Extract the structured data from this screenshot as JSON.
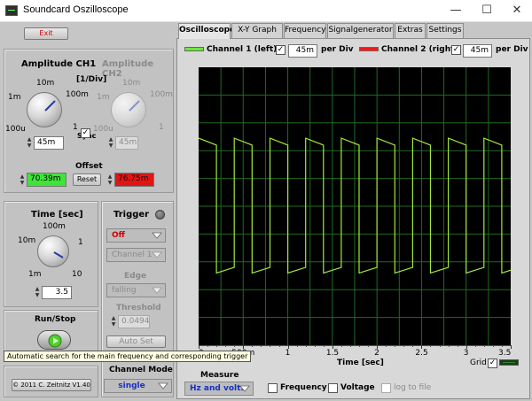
{
  "window": {
    "title": "Soundcard Oszilloscope",
    "minimize": "—",
    "maximize": "☐",
    "close": "✕"
  },
  "left": {
    "exit_label": "Exit",
    "amp_ch1_title": "Amplitude CH1",
    "amp_ch2_title": "Amplitude CH2",
    "amp_unit": "[1/Div]",
    "amp_ch1_scale": {
      "top": "10m",
      "upper_left": "1m",
      "upper_right": "100m",
      "lower_left": "100u",
      "lower_right": "1"
    },
    "amp_ch2_scale": {
      "top": "10m",
      "upper_left": "1m",
      "upper_right": "100m",
      "lower_left": "100u",
      "lower_right": "1"
    },
    "amp_ch1_value": "45m",
    "amp_ch2_value": "45m",
    "sync_label": "Sync",
    "sync_checked": "✓",
    "offset_label": "Offset",
    "offset_ch1": "70.39m",
    "offset_ch2": "76.75m",
    "reset_label": "Reset",
    "time_title": "Time [sec]",
    "time_scale": {
      "top": "100m",
      "upper_left": "10m",
      "upper_right": "1",
      "lower_left": "1m",
      "lower_right": "10"
    },
    "time_value": "3.5",
    "trigger_title": "Trigger",
    "trigger_mode": "Off",
    "trigger_channel": "Channel 1",
    "edge_label": "Edge",
    "edge_value": "falling",
    "threshold_label": "Threshold",
    "threshold_value": "0.0494",
    "autoset_label": "Auto Set",
    "runstop_label": "Run/Stop",
    "channel_mode_label": "Channel Mode",
    "channel_mode_value": "single",
    "copyright": "© 2011  C. Zeitnitz V1.40"
  },
  "tabs": [
    {
      "label": "Oscilloscope",
      "active": true
    },
    {
      "label": "X-Y Graph"
    },
    {
      "label": "Frequency"
    },
    {
      "label": "Signalgenerator"
    },
    {
      "label": "Extras"
    },
    {
      "label": "Settings"
    }
  ],
  "channels": {
    "ch1_label": "Channel 1 (left)",
    "ch1_color": "#6ee83a",
    "ch1_checked": "✓",
    "ch1_per_div": "45m",
    "ch2_label": "Channel 2 (right)",
    "ch2_color": "#ff1a1a",
    "ch2_checked": "✓",
    "ch2_per_div": "45m",
    "per_div_label": "per Div"
  },
  "plot": {
    "x_ticks": [
      "0",
      "500m",
      "1",
      "1.5",
      "2",
      "2.5",
      "3",
      "3.5"
    ],
    "x_label": "Time [sec]",
    "grid_label": "Grid",
    "grid_checked": "✓",
    "signal_color": "#a4e83a"
  },
  "measure": {
    "label": "Measure",
    "value": "Hz and volts",
    "frequency_label": "Frequency",
    "voltage_label": "Voltage",
    "log_label": "log to file"
  },
  "tooltip": "Automatic search for the main frequency and corresponding trigger",
  "chart_data": {
    "type": "line",
    "title": "",
    "xlabel": "Time [sec]",
    "ylabel": "",
    "xlim": [
      0,
      3.5
    ],
    "ylim": [
      -5,
      5
    ],
    "grid": true,
    "series": [
      {
        "color": "#a4e83a",
        "x": [
          0.0,
          0.2,
          0.2,
          0.4,
          0.4,
          0.6,
          0.6,
          0.8,
          0.8,
          1.0,
          1.0,
          1.2,
          1.2,
          1.4,
          1.4,
          1.6,
          1.6,
          1.8,
          1.8,
          2.0,
          2.0,
          2.2,
          2.2,
          2.4,
          2.4,
          2.6,
          2.6,
          2.8,
          2.8,
          3.0,
          3.0,
          3.2,
          3.2,
          3.4,
          3.4,
          3.5
        ],
        "y": [
          2.45,
          2.2,
          -2.4,
          -2.2,
          2.45,
          2.2,
          -2.4,
          -2.2,
          2.45,
          2.2,
          -2.4,
          -2.2,
          2.45,
          2.2,
          -2.4,
          -2.2,
          2.45,
          2.2,
          -2.4,
          -2.2,
          2.45,
          2.2,
          -2.4,
          -2.2,
          2.45,
          2.2,
          -2.4,
          -2.2,
          2.45,
          2.2,
          -2.4,
          -2.2,
          2.45,
          2.2,
          -2.4,
          -2.3
        ]
      }
    ]
  }
}
